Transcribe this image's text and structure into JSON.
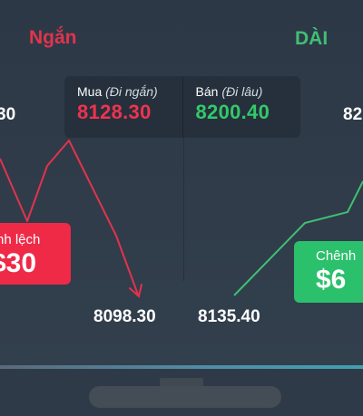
{
  "header": {
    "short_label": "Ngắn",
    "long_label": "DÀI"
  },
  "panel": {
    "buy_caption": "Mua",
    "buy_caption_note": "(Đi ngắn)",
    "buy_price": "8128.30",
    "sell_caption": "Bán",
    "sell_caption_note": "(Đi lâu)",
    "sell_price": "8200.40"
  },
  "edges": {
    "left_price_fragment": "30",
    "right_price_fragment": "82"
  },
  "spread_short": {
    "label": "nh lệch",
    "value": "$30"
  },
  "spread_long": {
    "label": "Chênh",
    "value": "$6"
  },
  "lows": {
    "short_low": "8098.30",
    "long_low": "8135.40"
  },
  "colors": {
    "short": "#ee2a47",
    "long": "#2bc06b",
    "background": "#2e3a47"
  }
}
